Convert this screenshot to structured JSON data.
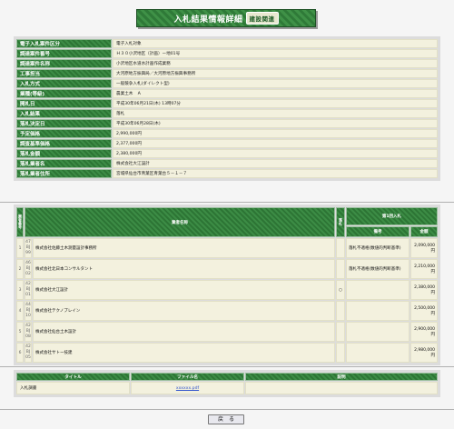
{
  "page": {
    "title": "入札結果情報詳細",
    "badge": "建設関連"
  },
  "info": [
    {
      "label": "電子入札案件区分",
      "value": "電子入札対象"
    },
    {
      "label": "調達案件番号",
      "value": "Ｈ３０小沢地区（計画）ー地01号"
    },
    {
      "label": "調達案件名称",
      "value": "小沢地区水道水計画作成業務"
    },
    {
      "label": "工事担当",
      "value": "大河原地方振興局／大河原地方振興事務所"
    },
    {
      "label": "入札方式",
      "value": "一般競争入札(ダイレクト型)"
    },
    {
      "label": "業種(等級)",
      "value": "農業土木　Ａ"
    },
    {
      "label": "開札日",
      "value": "平成30年06月21日(木) 13時07分"
    },
    {
      "label": "入札結果",
      "value": "落札"
    },
    {
      "label": "落札決定日",
      "value": "平成30年06月28日(木)"
    },
    {
      "label": "予定価格",
      "value": "2,990,000円"
    },
    {
      "label": "調査基準価格",
      "value": "2,377,000円"
    },
    {
      "label": "落札金額",
      "value": "2,380,000円"
    },
    {
      "label": "落札業者名",
      "value": "株式会社大江設計"
    },
    {
      "label": "落札業者住所",
      "value": "宮城県仙台市青葉区青葉台５－１－７"
    }
  ],
  "results": {
    "headers": {
      "no": "業者番号",
      "name": "業者名称",
      "award": "落札",
      "round1": "第1回入札",
      "remark": "備考",
      "amount": "金額"
    },
    "rows": [
      {
        "no": "1",
        "code": "47 BJ 99",
        "name": "株式会社佐藤土木測量設計事務所",
        "award": "",
        "remark": "落札不適格(数値的判断基準)",
        "amount": "2,090,000円"
      },
      {
        "no": "2",
        "code": "46 BJ 02",
        "name": "株式会社北日本コンサルタント",
        "award": "",
        "remark": "落札不適格(数値的判断基準)",
        "amount": "2,210,000円"
      },
      {
        "no": "3",
        "code": "42 BJ 01",
        "name": "株式会社大江設計",
        "award": "○",
        "remark": "",
        "amount": "2,380,000円"
      },
      {
        "no": "4",
        "code": "44 BJ 10",
        "name": "株式会社テクノプレイン",
        "award": "",
        "remark": "",
        "amount": "2,500,000円"
      },
      {
        "no": "5",
        "code": "42 BJ 08",
        "name": "株式会社仙台土木設計",
        "award": "",
        "remark": "",
        "amount": "2,900,000円"
      },
      {
        "no": "6",
        "code": "42 BJ 05",
        "name": "株式会社サトー技建",
        "award": "",
        "remark": "",
        "amount": "2,980,000円"
      }
    ]
  },
  "files": {
    "headers": {
      "title": "タイトル",
      "file": "ファイル名",
      "desc": "説明"
    },
    "rows": [
      {
        "title": "入札調書",
        "file": "xxxxxx.pdf",
        "desc": ""
      }
    ]
  },
  "buttons": {
    "back": "戻　る"
  }
}
